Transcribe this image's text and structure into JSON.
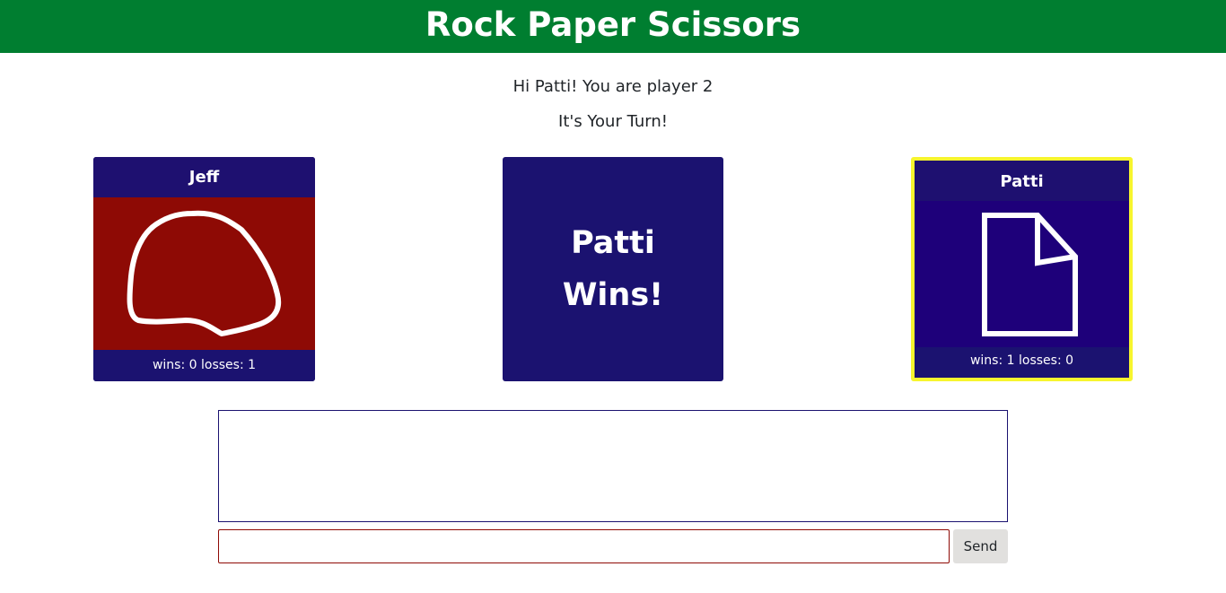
{
  "header": {
    "title": "Rock Paper Scissors"
  },
  "greeting": "Hi Patti! You are player 2",
  "turn_message": "It's Your Turn!",
  "player1": {
    "name": "Jeff",
    "choice_icon": "rock-icon",
    "stats": "wins: 0 losses: 1",
    "color": "#8e0a05"
  },
  "result": {
    "text": "Patti Wins!",
    "color": "#1b1270"
  },
  "player2": {
    "name": "Patti",
    "choice_icon": "paper-icon",
    "stats": "wins: 1 losses: 0",
    "highlight_color": "#f7f52e",
    "color": "#1e007a"
  },
  "chat": {
    "input_value": "",
    "input_placeholder": "",
    "send_label": "Send"
  },
  "colors": {
    "header_bg": "#007e30",
    "card_bg": "#1b1270"
  }
}
